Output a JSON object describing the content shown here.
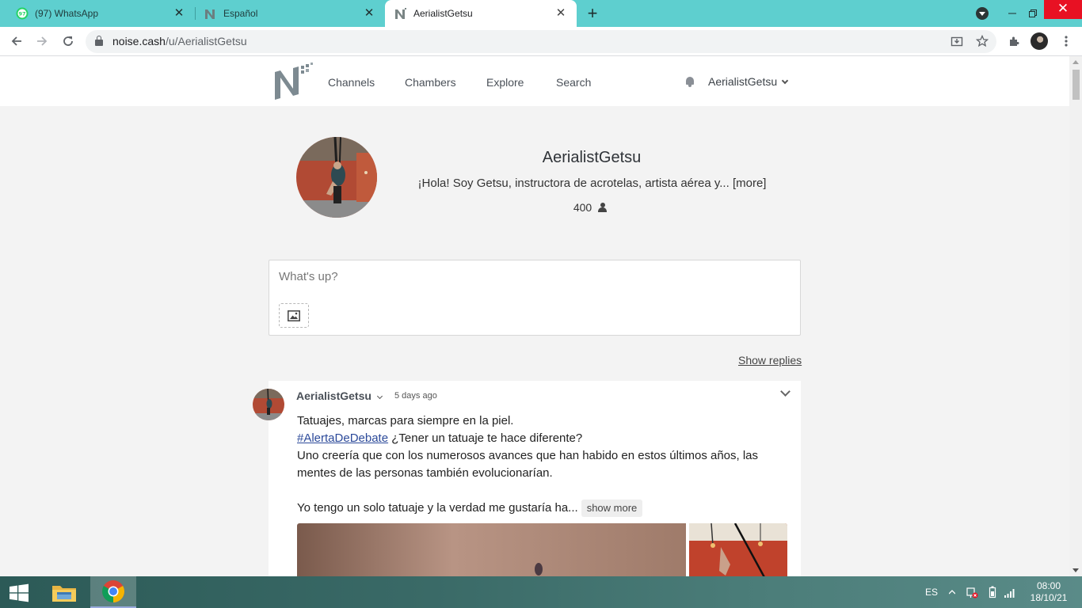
{
  "browser": {
    "tabs": [
      {
        "title": "(97) WhatsApp",
        "badge": "97"
      },
      {
        "title": "Español"
      },
      {
        "title": "AerialistGetsu"
      }
    ],
    "url_host": "noise.cash",
    "url_path": "/u/AerialistGetsu"
  },
  "site_nav": {
    "links": [
      "Channels",
      "Chambers",
      "Explore",
      "Search"
    ],
    "username": "AerialistGetsu"
  },
  "profile": {
    "name": "AerialistGetsu",
    "bio": "¡Hola! Soy Getsu, instructora de acrotelas, artista aérea y...",
    "bio_more": "[more]",
    "followers": "400"
  },
  "composer": {
    "placeholder": "What's up?"
  },
  "feed": {
    "show_replies_label": "Show replies",
    "post": {
      "author": "AerialistGetsu",
      "time": "5 days ago",
      "line1": "Tatuajes, marcas para siempre en la piel.",
      "hashtag": "#AlertaDeDebate",
      "line2_rest": "¿Tener un tatuaje te hace diferente?",
      "line3": "Uno creería que con los numerosos avances que han habido en estos últimos años, las mentes de las personas también evolucionarían.",
      "line4": "Yo tengo un solo tatuaje y la verdad me gustaría ha...",
      "show_more": "show more"
    }
  },
  "taskbar": {
    "lang": "ES",
    "time": "08:00",
    "date": "18/10/21"
  }
}
